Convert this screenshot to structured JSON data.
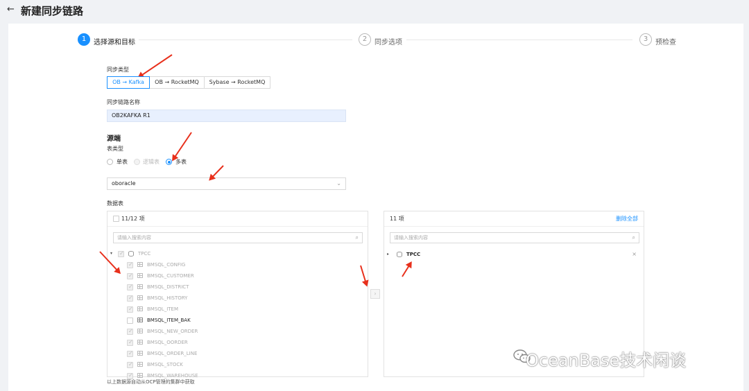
{
  "header": {
    "back_icon": "arrow-left-icon",
    "title": "新建同步链路"
  },
  "steps": [
    {
      "num": "1",
      "label": "选择源和目标",
      "active": true
    },
    {
      "num": "2",
      "label": "同步选项",
      "active": false
    },
    {
      "num": "3",
      "label": "预检查",
      "active": false
    }
  ],
  "sync_type": {
    "label": "同步类型",
    "options": [
      "OB → Kafka",
      "OB → RocketMQ",
      "Sybase → RocketMQ"
    ],
    "selected": "OB → Kafka"
  },
  "link_name": {
    "label": "同步链路名称",
    "value": "OB2KAFKA R1"
  },
  "source": {
    "title": "源端",
    "table_type_label": "表类型",
    "table_types": [
      "单表",
      "逻辑表",
      "多表"
    ],
    "selected_table_type": "多表",
    "cluster_value": "oboracle"
  },
  "data_tables": {
    "label": "数据表",
    "left": {
      "count": "11/12 项",
      "search_placeholder": "请输入搜索内容",
      "root": "TPCC",
      "items": [
        {
          "name": "BMSQL_CONFIG",
          "checked": true
        },
        {
          "name": "BMSQL_CUSTOMER",
          "checked": true
        },
        {
          "name": "BMSQL_DISTRICT",
          "checked": true
        },
        {
          "name": "BMSQL_HISTORY",
          "checked": true
        },
        {
          "name": "BMSQL_ITEM",
          "checked": true
        },
        {
          "name": "BMSQL_ITEM_BAK",
          "checked": false
        },
        {
          "name": "BMSQL_NEW_ORDER",
          "checked": true
        },
        {
          "name": "BMSQL_OORDER",
          "checked": true
        },
        {
          "name": "BMSQL_ORDER_LINE",
          "checked": true
        },
        {
          "name": "BMSQL_STOCK",
          "checked": true
        },
        {
          "name": "BMSQL_WAREHOUSE",
          "checked": true
        }
      ]
    },
    "right": {
      "count": "11 项",
      "clear_all": "删除全部",
      "search_placeholder": "请输入搜索内容",
      "root": "TPCC"
    },
    "footnote": "以上数据源自动从OCP管理的集群中获取"
  },
  "watermark": "OceanBase技术闲谈",
  "colors": {
    "accent": "#1890ff",
    "annotation_arrow": "#e8301c"
  }
}
